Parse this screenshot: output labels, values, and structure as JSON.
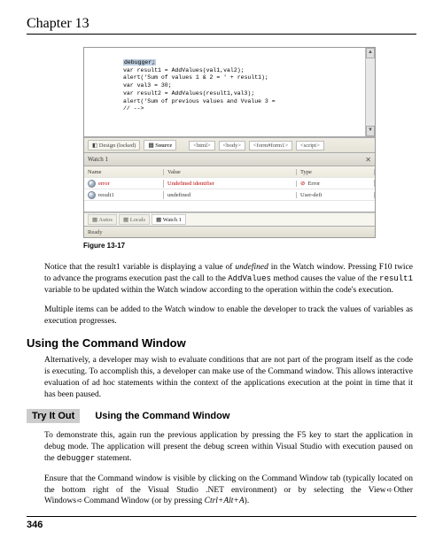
{
  "chapter": "Chapter 13",
  "figure": {
    "code_lines": [
      "debugger;",
      "var result1 = AddValues(val1,val2);",
      "alert('Sum of values 1 & 2 = ' + result1);",
      "var val3 = 30;",
      "var result2 = AddValues(result1,val3);",
      "alert('Sum of previous values and Vvalue 3 =",
      "// -->"
    ],
    "tabs": {
      "design": "Design (locked)",
      "source": "Source"
    },
    "crumbs": [
      "<html>",
      "<body>",
      "<form#form1>",
      "<script>"
    ],
    "watch": {
      "title": "Watch 1",
      "headers": {
        "name": "Name",
        "value": "Value",
        "type": "Type"
      },
      "rows": [
        {
          "name": "error",
          "value": "Undefined identifier",
          "type": "Error",
          "red": true
        },
        {
          "name": "result1",
          "value": "undefined",
          "type": "User-defi",
          "red": false
        }
      ]
    },
    "bottom_tabs": {
      "autos": "Autos",
      "locals": "Locals",
      "watch1": "Watch 1"
    },
    "status": "Ready",
    "caption": "Figure 13-17"
  },
  "para1_a": "Notice that the result1 variable is displaying a value of ",
  "para1_b": "undefined",
  "para1_c": " in the Watch window. Pressing F10 twice to advance the programs execution past the call to the ",
  "para1_d": "AddValues",
  "para1_e": " method causes the value of the ",
  "para1_f": "result1",
  "para1_g": " variable to be updated within the Watch window according to the operation within the code's execution.",
  "para2": "Multiple items can be added to the Watch window to enable the developer to track the values of variables as execution progresses.",
  "section": "Using the Command Window",
  "para3": "Alternatively, a developer may wish to evaluate conditions that are not part of the program itself as the code is executing. To accomplish this, a developer can make use of the Command window. This allows interactive evaluation of ad hoc statements within the context of the applications execution at the point in time that it has been paused.",
  "tryit": {
    "label": "Try It Out",
    "title": "Using the Command Window"
  },
  "para4_a": "To demonstrate this, again run the previous application by pressing the F5 key to start the application in debug mode. The application will present the debug screen within Visual Studio with execution paused on the ",
  "para4_b": "debugger",
  "para4_c": " statement.",
  "para5_a": "Ensure that the Command window is visible by clicking on the Command Window tab (typically located on the bottom right of the Visual Studio .NET environment) or by selecting the View",
  "para5_b": "Other Windows",
  "para5_c": "Command Window (or by pressing ",
  "para5_d": "Ctrl+Alt+A",
  "para5_e": ").",
  "pagenum": "346"
}
